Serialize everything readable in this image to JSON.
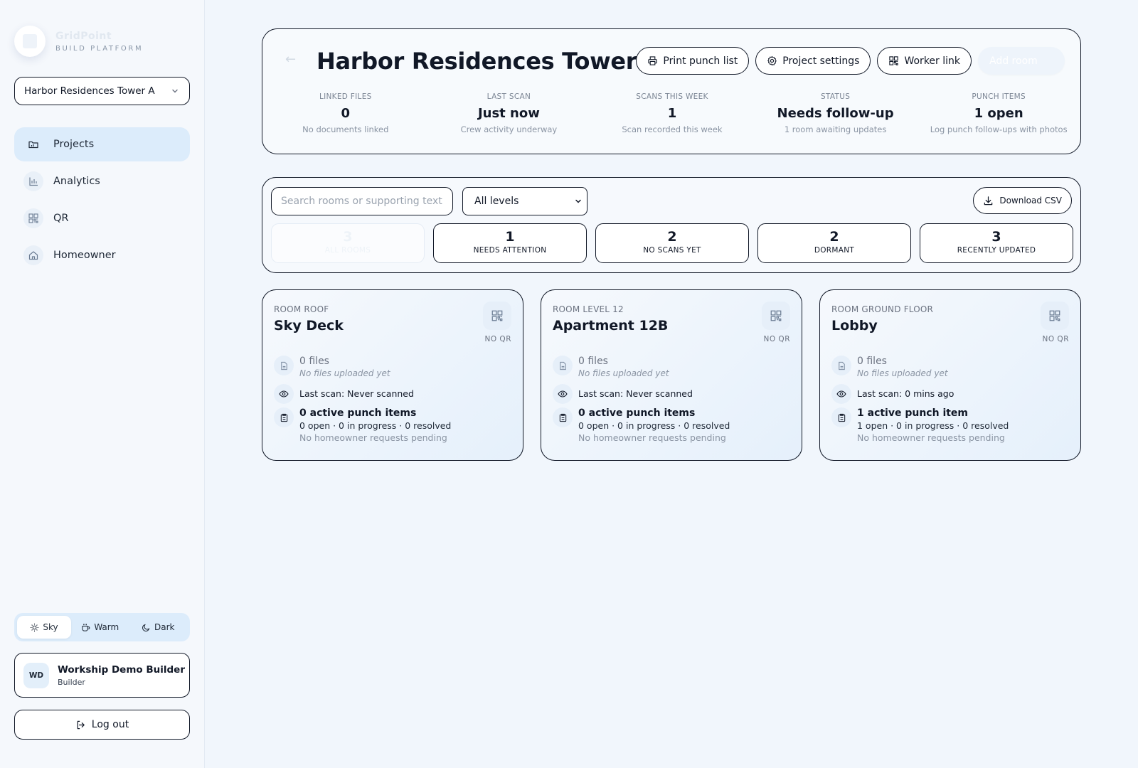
{
  "brand": {
    "name": "GridPoint",
    "subtitle": "BUILD PLATFORM"
  },
  "project_selector": {
    "value": "Harbor Residences Tower A"
  },
  "nav": [
    {
      "label": "Projects",
      "icon": "folder-icon"
    },
    {
      "label": "Analytics",
      "icon": "bar-chart-icon"
    },
    {
      "label": "QR",
      "icon": "qr-icon"
    },
    {
      "label": "Homeowner",
      "icon": "home-icon"
    }
  ],
  "theme": {
    "options": [
      "Sky",
      "Warm",
      "Dark"
    ],
    "selected": "Sky"
  },
  "user": {
    "initials": "WD",
    "name": "Workship Demo Builder",
    "role": "Builder"
  },
  "logout_label": "Log out",
  "header": {
    "title": "Harbor Residences Tower A",
    "buttons": {
      "print": "Print punch list",
      "settings": "Project settings",
      "worker": "Worker link",
      "add_room": "Add room"
    },
    "stats": [
      {
        "label": "LINKED FILES",
        "value": "0",
        "sub": "No documents linked"
      },
      {
        "label": "LAST SCAN",
        "value": "Just now",
        "sub": "Crew activity underway"
      },
      {
        "label": "SCANS THIS WEEK",
        "value": "1",
        "sub": "Scan recorded this week"
      },
      {
        "label": "STATUS",
        "value": "Needs follow-up",
        "sub": "1 room awaiting updates"
      },
      {
        "label": "PUNCH ITEMS",
        "value": "1 open",
        "sub": "Log punch follow-ups with photos"
      }
    ]
  },
  "filters": {
    "search_placeholder": "Search rooms or supporting text",
    "level_value": "All levels",
    "download_label": "Download CSV",
    "tiles": [
      {
        "count": "3",
        "label": "ALL ROOMS"
      },
      {
        "count": "1",
        "label": "NEEDS ATTENTION"
      },
      {
        "count": "2",
        "label": "NO SCANS YET"
      },
      {
        "count": "2",
        "label": "DORMANT"
      },
      {
        "count": "3",
        "label": "RECENTLY UPDATED"
      }
    ]
  },
  "rooms": [
    {
      "tag": "ROOM ROOF",
      "name": "Sky Deck",
      "qr": "NO QR",
      "files": "0 files",
      "files_note": "No files uploaded yet",
      "last_scan": "Last scan: Never scanned",
      "punch": "0 active punch items",
      "punch_counts": "0 open · 0 in progress · 0 resolved",
      "requests": "No homeowner requests pending"
    },
    {
      "tag": "ROOM LEVEL 12",
      "name": "Apartment 12B",
      "qr": "NO QR",
      "files": "0 files",
      "files_note": "No files uploaded yet",
      "last_scan": "Last scan: Never scanned",
      "punch": "0 active punch items",
      "punch_counts": "0 open · 0 in progress · 0 resolved",
      "requests": "No homeowner requests pending"
    },
    {
      "tag": "ROOM GROUND FLOOR",
      "name": "Lobby",
      "qr": "NO QR",
      "files": "0 files",
      "files_note": "No files uploaded yet",
      "last_scan": "Last scan: 0 mins ago",
      "punch": "1 active punch item",
      "punch_counts": "1 open · 0 in progress · 0 resolved",
      "requests": "No homeowner requests pending"
    }
  ],
  "colors": {
    "accent_bg": "#dcecfb",
    "border": "#111827",
    "muted": "#6b7280"
  }
}
